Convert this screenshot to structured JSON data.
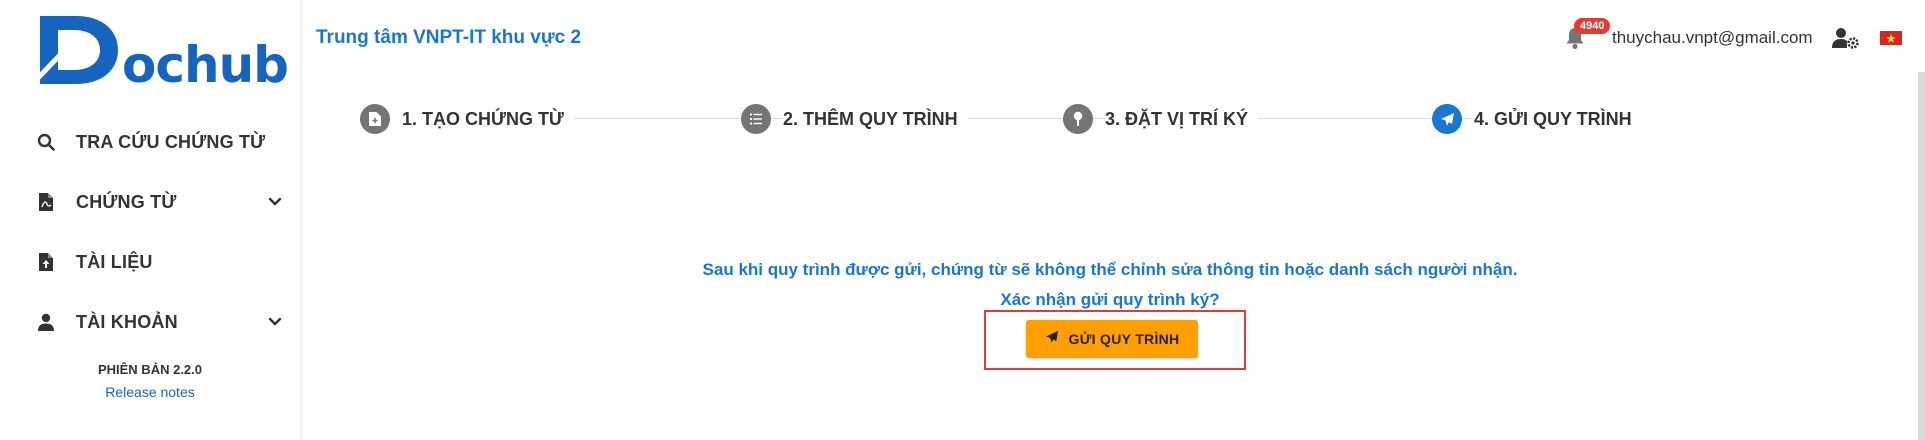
{
  "brand": {
    "logo_text": "ochub"
  },
  "sidebar": {
    "items": [
      {
        "label": "TRA CỨU CHỨNG TỪ",
        "icon": "search-icon"
      },
      {
        "label": "CHỨNG TỪ",
        "icon": "file-pdf-icon",
        "expandable": true
      },
      {
        "label": "TÀI LIỆU",
        "icon": "file-upload-icon"
      },
      {
        "label": "TÀI KHOẢN",
        "icon": "user-icon",
        "expandable": true
      }
    ],
    "version": "PHIÊN BẢN 2.2.0",
    "release_notes": "Release notes"
  },
  "header": {
    "org_title": "Trung tâm VNPT-IT khu vực 2",
    "notification_count": "4940",
    "user_email": "thuychau.vnpt@gmail.com",
    "language_flag": "vietnam-flag-icon"
  },
  "stepper": {
    "steps": [
      {
        "label": "1. TẠO CHỨNG TỪ",
        "icon": "file-add-icon",
        "active": false
      },
      {
        "label": "2. THÊM QUY TRÌNH",
        "icon": "list-icon",
        "active": false
      },
      {
        "label": "3. ĐẶT VỊ TRÍ KÝ",
        "icon": "pin-icon",
        "active": false
      },
      {
        "label": "4. GỬI QUY TRÌNH",
        "icon": "paper-plane-icon",
        "active": true
      }
    ]
  },
  "main": {
    "message_line1": "Sau khi quy trình được gửi, chứng từ sẽ không thể chỉnh sửa thông tin hoặc danh sách người nhận.",
    "message_line2": "Xác nhận gửi quy trình ký?",
    "send_button_label": "GỬI QUY TRÌNH"
  },
  "colors": {
    "brand_blue": "#1565c0",
    "link_blue": "#1976d2",
    "button_orange": "#ffa000",
    "highlight_red": "#e53935",
    "step_grey": "#757575"
  }
}
